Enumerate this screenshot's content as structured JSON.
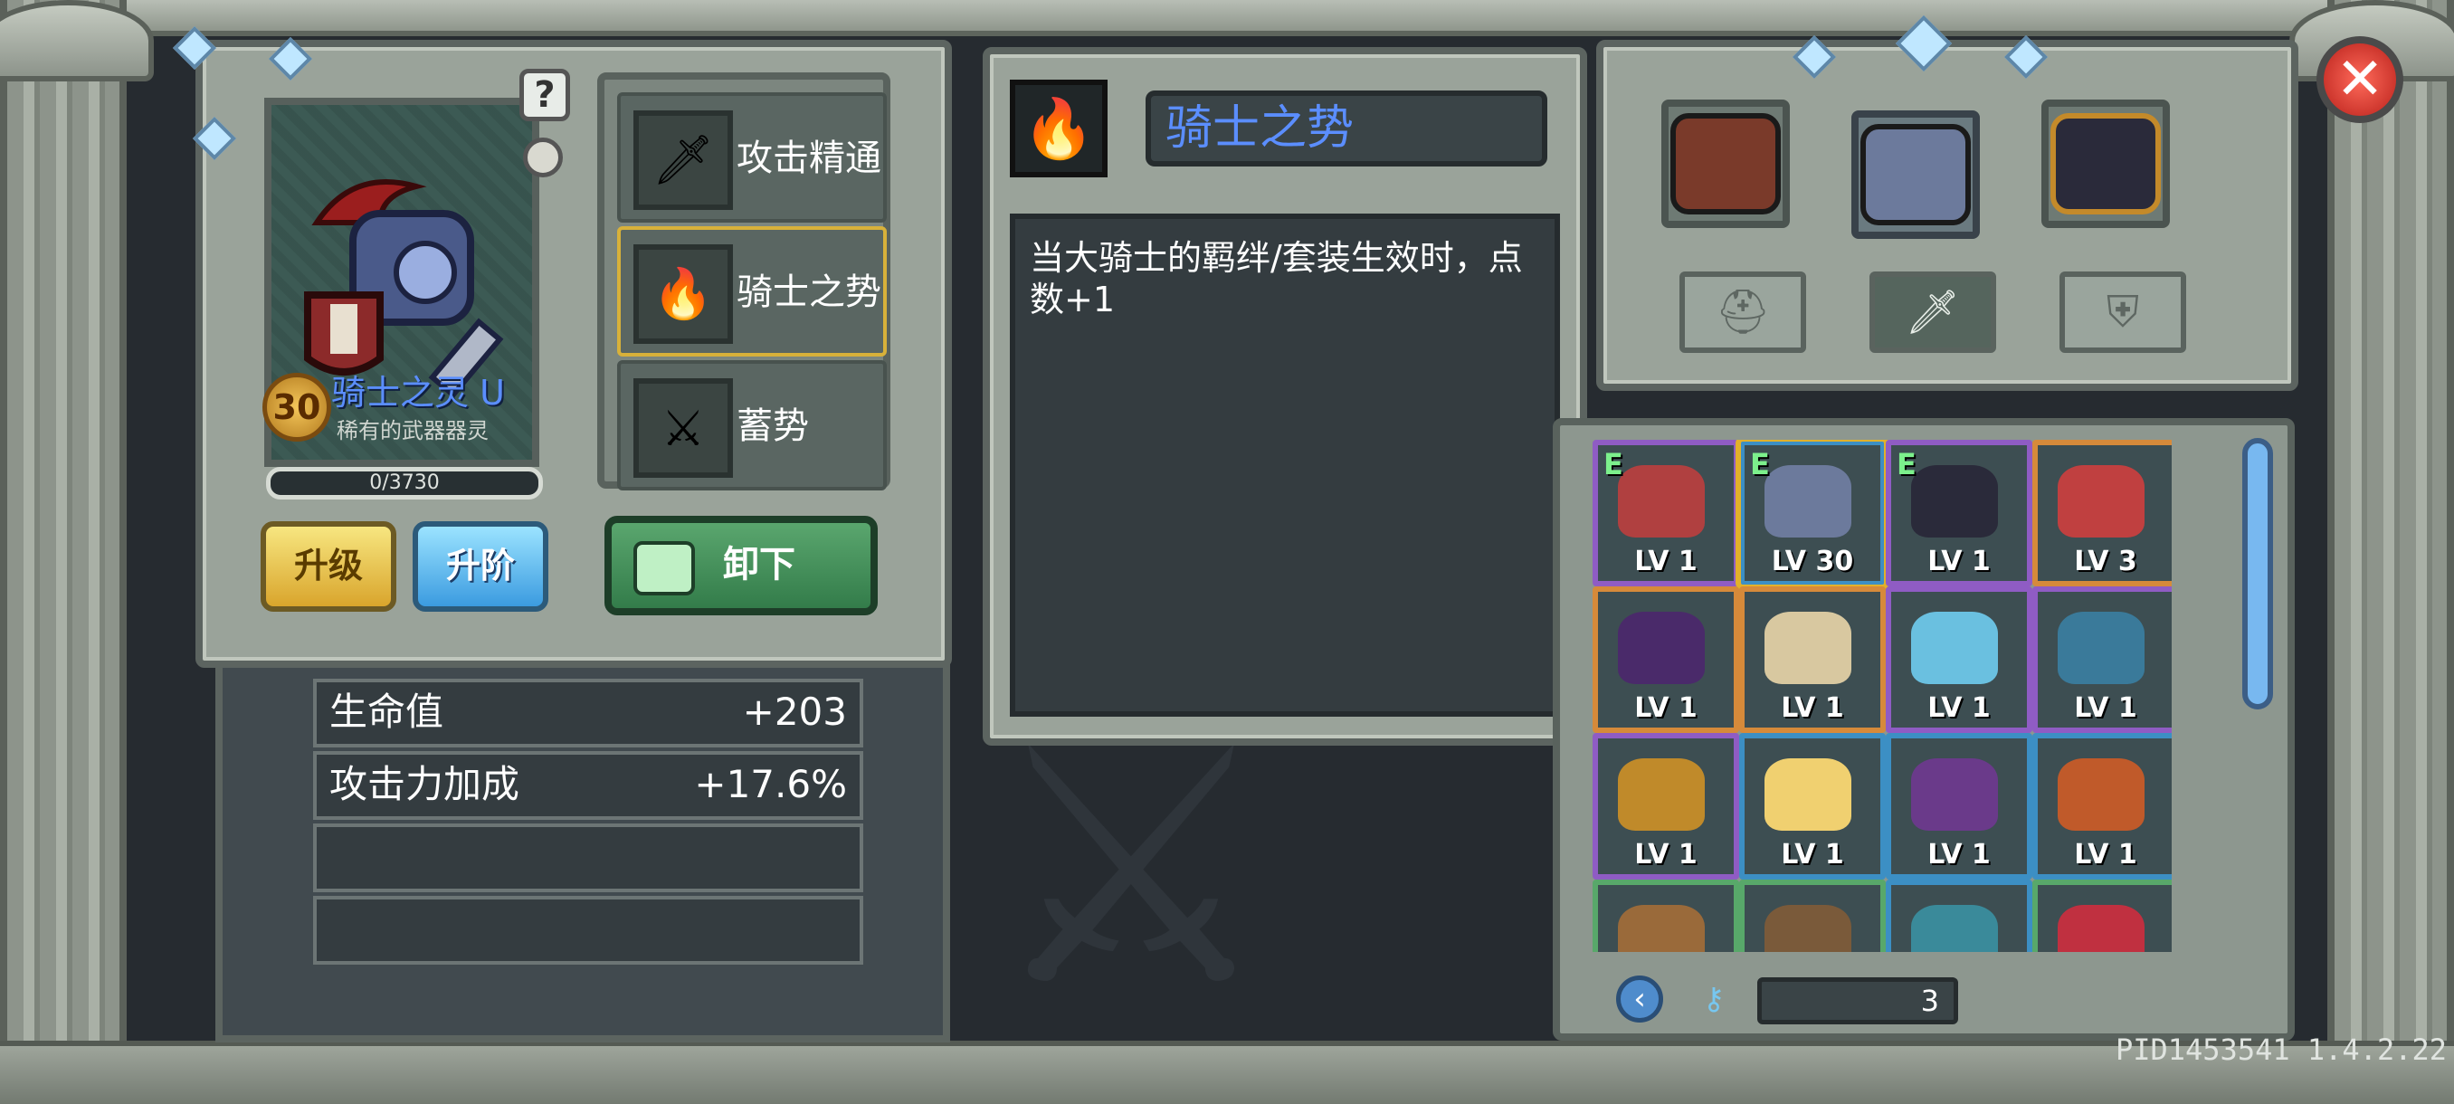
{
  "pet": {
    "level": "30",
    "name": "骑士之灵 U",
    "subtitle": "稀有的武器器灵",
    "xp": "0/3730"
  },
  "buttons": {
    "help": "?",
    "upgrade": "升级",
    "advance": "升阶",
    "unequip": "卸下",
    "close": "✕"
  },
  "skills": [
    {
      "label": "攻击精通",
      "icon": "sword-icon"
    },
    {
      "label": "骑士之势",
      "icon": "flame-icon"
    },
    {
      "label": "蓄势",
      "icon": "charge-icon"
    }
  ],
  "stats": [
    {
      "name": "生命值",
      "value": "+203"
    },
    {
      "name": "攻击力加成",
      "value": "+17.6%"
    },
    {
      "name": "",
      "value": ""
    },
    {
      "name": "",
      "value": ""
    }
  ],
  "detail": {
    "title": "骑士之势",
    "description": "当大骑士的羁绊/套装生效时，点数+1"
  },
  "equip_types": [
    "helmet-icon",
    "sword-icon",
    "shield-icon"
  ],
  "inventory": [
    {
      "tag": "E",
      "lv": "LV 1",
      "color": "purple"
    },
    {
      "tag": "E",
      "lv": "LV 30",
      "color": "blue"
    },
    {
      "tag": "E",
      "lv": "LV 1",
      "color": "purple"
    },
    {
      "tag": "",
      "lv": "LV 3",
      "color": "orange"
    },
    {
      "tag": "",
      "lv": "LV 1",
      "color": "orange"
    },
    {
      "tag": "",
      "lv": "LV 1",
      "color": "orange"
    },
    {
      "tag": "",
      "lv": "LV 1",
      "color": "purple"
    },
    {
      "tag": "",
      "lv": "LV 1",
      "color": "purple"
    },
    {
      "tag": "",
      "lv": "LV 1",
      "color": "purple"
    },
    {
      "tag": "",
      "lv": "LV 1",
      "color": "blue"
    },
    {
      "tag": "",
      "lv": "LV 1",
      "color": "blue"
    },
    {
      "tag": "",
      "lv": "LV 1",
      "color": "blue"
    },
    {
      "tag": "",
      "lv": "",
      "color": "green"
    },
    {
      "tag": "",
      "lv": "",
      "color": "green"
    },
    {
      "tag": "",
      "lv": "",
      "color": "blue"
    },
    {
      "tag": "",
      "lv": "",
      "color": "green"
    }
  ],
  "pagination": {
    "count": "3"
  },
  "version": "PID1453541 1.4.2.22"
}
